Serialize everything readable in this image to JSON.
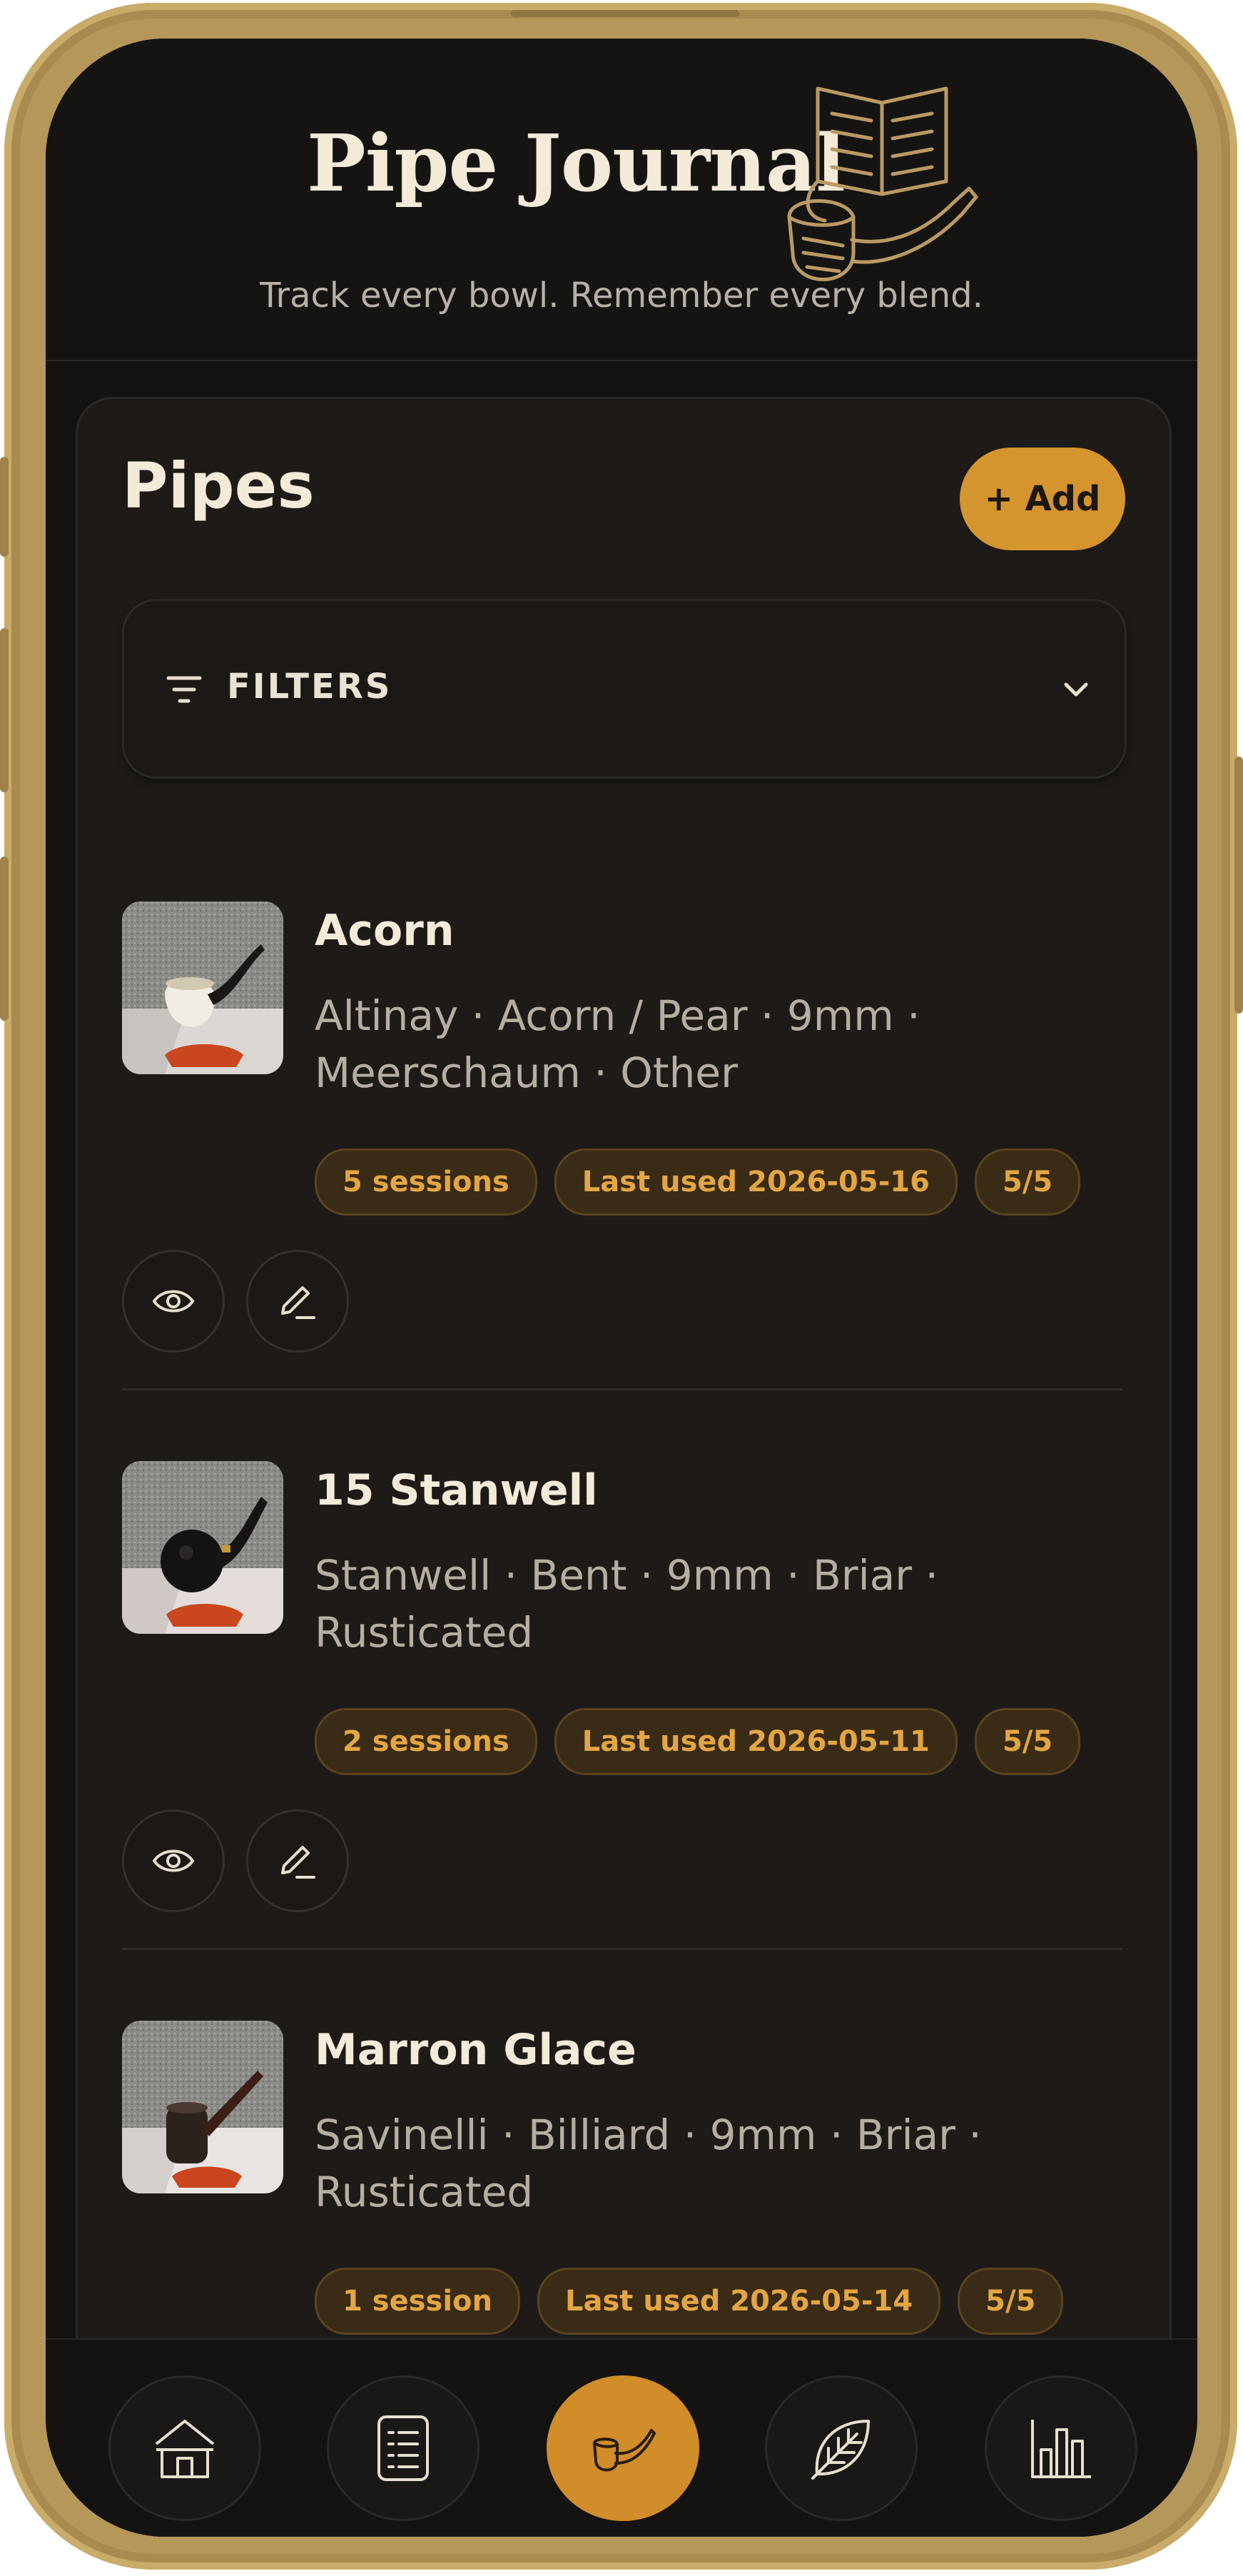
{
  "header": {
    "title": "Pipe Journal",
    "tagline": "Track every bowl. Remember every blend."
  },
  "section": {
    "title": "Pipes",
    "add_label": "+ Add",
    "filters_label": "FILTERS"
  },
  "pipes": [
    {
      "name": "Acorn",
      "description": "Altinay · Acorn / Pear · 9mm · Meerschaum · Other",
      "sessions": "5 sessions",
      "last_used": "Last used 2026-05-16",
      "rating": "5/5"
    },
    {
      "name": "15 Stanwell",
      "description": "Stanwell · Bent · 9mm · Briar · Rusticated",
      "sessions": "2 sessions",
      "last_used": "Last used 2026-05-11",
      "rating": "5/5"
    },
    {
      "name": "Marron Glace",
      "description": "Savinelli · Billiard · 9mm · Briar · Rusticated",
      "sessions": "1 session",
      "last_used": "Last used 2026-05-14",
      "rating": "5/5"
    }
  ],
  "icons": {
    "logo": "book-and-pipe-icon",
    "filter": "filter-lines-icon",
    "expand": "chevron-down-icon",
    "view": "eye-icon",
    "edit": "pencil-icon"
  },
  "nav": [
    {
      "icon": "home-icon",
      "active": false
    },
    {
      "icon": "list-icon",
      "active": false
    },
    {
      "icon": "pipe-icon",
      "active": true
    },
    {
      "icon": "tobacco-leaf-icon",
      "active": false
    },
    {
      "icon": "bar-chart-icon",
      "active": false
    }
  ],
  "colors": {
    "accent": "#d4952f",
    "background": "#131211",
    "card": "#1d1a17",
    "text": "#f3ead8",
    "muted": "#b7aea2",
    "chip_text": "#e3a643",
    "chip_bg": "#3a2b16",
    "frame": "#b6975a"
  }
}
